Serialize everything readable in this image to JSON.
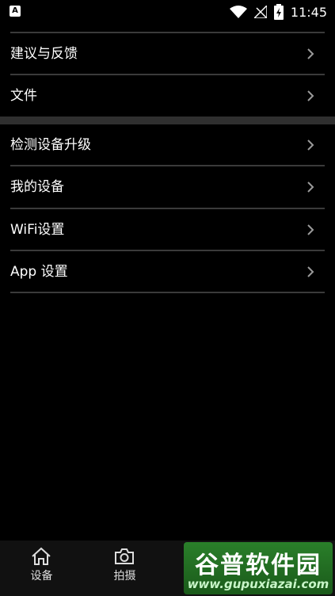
{
  "status_bar": {
    "notification_badge": "A",
    "time": "11:45",
    "icons": [
      "wifi-icon",
      "signal-icon",
      "battery-charging-icon"
    ]
  },
  "menu": {
    "group1": [
      {
        "label": "建议与反馈",
        "icon": "chevron-right-icon"
      },
      {
        "label": "文件",
        "icon": "chevron-right-icon"
      }
    ],
    "group2": [
      {
        "label": "检测设备升级",
        "icon": "chevron-right-icon"
      },
      {
        "label": "我的设备",
        "icon": "chevron-right-icon"
      },
      {
        "label": "WiFi设置",
        "icon": "chevron-right-icon"
      },
      {
        "label": "App 设置",
        "icon": "chevron-right-icon"
      }
    ]
  },
  "bottom_nav": [
    {
      "label": "设备",
      "icon": "home-icon"
    },
    {
      "label": "拍摄",
      "icon": "camera-icon"
    }
  ],
  "watermark": {
    "title": "谷普软件园",
    "url": "www.gupuxiazai.com"
  },
  "colors": {
    "background": "#000000",
    "divider": "#3a3a3a",
    "section_gap": "#2f2f2f",
    "chevron": "#9a9a9a",
    "watermark": "#2a7f2a"
  }
}
